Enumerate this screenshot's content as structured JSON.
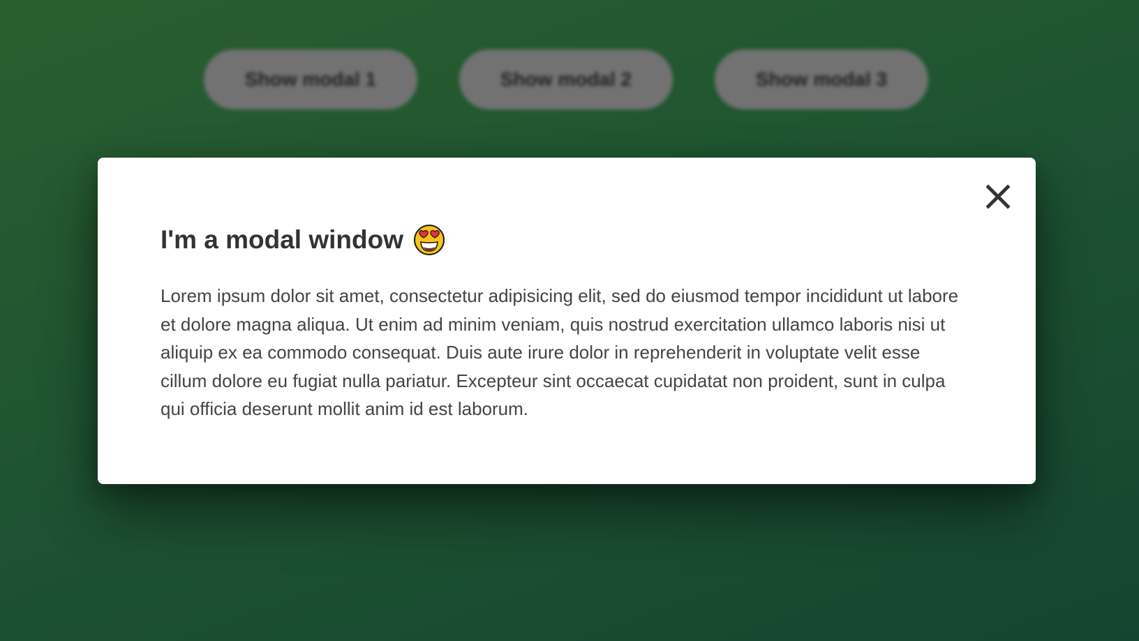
{
  "page": {
    "buttons": [
      {
        "label": "Show modal 1"
      },
      {
        "label": "Show modal 2"
      },
      {
        "label": "Show modal 3"
      }
    ]
  },
  "modal": {
    "title": "I'm a modal window",
    "title_emoji": "smiling-face-with-heart-eyes-icon",
    "body": "Lorem ipsum dolor sit amet, consectetur adipisicing elit, sed do eiusmod tempor incididunt ut labore et dolore magna aliqua. Ut enim ad minim veniam, quis nostrud exercitation ullamco laboris nisi ut aliquip ex ea commodo consequat. Duis aute irure dolor in reprehenderit in voluptate velit esse cillum dolore eu fugiat nulla pariatur. Excepteur sint occaecat cupidatat non proident, sunt in culpa qui officia deserunt mollit anim id est laborum.",
    "close_icon": "close-icon"
  },
  "colors": {
    "background_start": "#2e6432",
    "background_end": "#174a34",
    "button_bg": "#7a7a7a",
    "modal_bg": "#ffffff",
    "text": "#333333"
  }
}
